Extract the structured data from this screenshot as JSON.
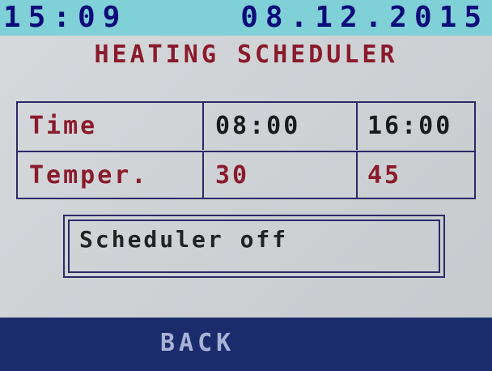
{
  "header": {
    "time": "15:09",
    "date": "08.12.2015",
    "colors": {
      "bar": "#7fd0d7",
      "text": "#0b0b7a"
    }
  },
  "title": "HEATING SCHEDULER",
  "schedule_table": {
    "rows": [
      {
        "label": "Time",
        "values": [
          "08:00",
          "16:00"
        ]
      },
      {
        "label": "Temper.",
        "values": [
          "30",
          "45"
        ]
      }
    ]
  },
  "scheduler_status": "Scheduler off",
  "footer": {
    "back_label": "BACK",
    "color": "#1a2c6b"
  }
}
